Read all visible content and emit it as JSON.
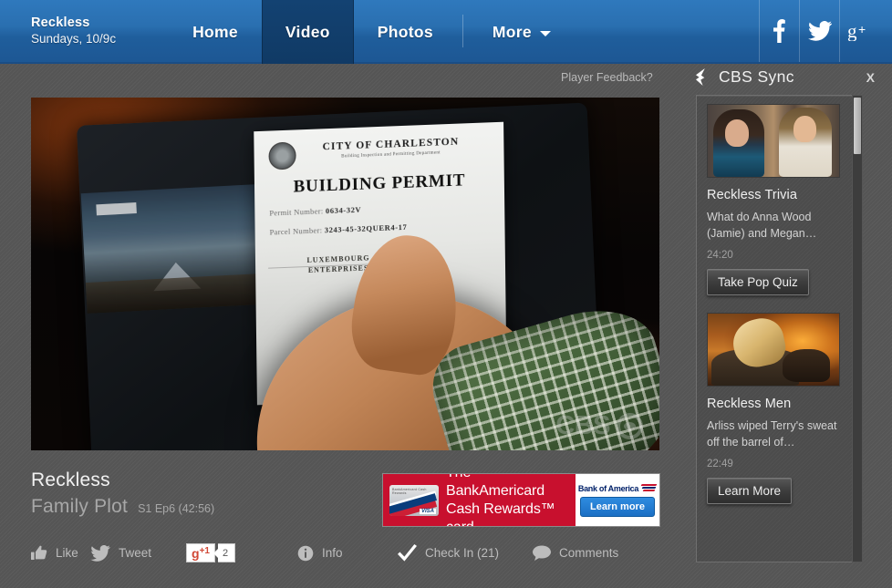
{
  "nav": {
    "brand_title": "Reckless",
    "brand_subtitle": "Sundays, 10/9c",
    "tabs": [
      {
        "label": "Home",
        "active": false
      },
      {
        "label": "Video",
        "active": true
      },
      {
        "label": "Photos",
        "active": false
      },
      {
        "label": "More",
        "active": false,
        "has_caret": true
      }
    ],
    "social": [
      {
        "name": "facebook-icon",
        "label": "f"
      },
      {
        "name": "twitter-icon",
        "label": "t"
      },
      {
        "name": "google-plus-icon",
        "label": "g+"
      }
    ]
  },
  "player_feedback": "Player Feedback?",
  "video": {
    "show_title": "Reckless",
    "episode_title": "Family Plot",
    "episode_number": "S1 Ep6 (42:56)",
    "watermark": "CBS",
    "frame": {
      "permit_city": "CITY OF CHARLESTON",
      "permit_subhead": "Building Inspection and Permitting Department",
      "permit_title": "BUILDING PERMIT",
      "permit_number_label": "Permit Number:",
      "permit_number_value": "0634-32V",
      "parcel_number_label": "Parcel Number:",
      "parcel_number_value": "3243-45-32QUER4-17",
      "owner_line1": "LUXEMBOURG",
      "owner_line2": "ENTERPRISES"
    }
  },
  "ad": {
    "headline_line1": "The BankAmericard",
    "headline_line2": "Cash Rewards™ card",
    "card_mini_text": "BankAmericard   Cash Rewards",
    "card_network": "VISA",
    "advertiser": "Bank of America",
    "cta": "Learn more"
  },
  "actions": [
    {
      "name": "like-button",
      "icon": "thumbs-up-icon",
      "label": "Like"
    },
    {
      "name": "tweet-button",
      "icon": "twitter-bird-icon",
      "label": "Tweet"
    },
    {
      "name": "google-plus-one-button",
      "icon": "gplus-icon",
      "label": "g",
      "plus": "+1",
      "count": "2"
    },
    {
      "name": "info-button",
      "icon": "info-icon",
      "label": "Info"
    },
    {
      "name": "check-in-button",
      "icon": "checkmark-icon",
      "label": "Check In (21)"
    },
    {
      "name": "comments-button",
      "icon": "speech-bubble-icon",
      "label": "Comments"
    }
  ],
  "sync": {
    "title": "CBS Sync",
    "close_label": "X",
    "cards": [
      {
        "title": "Reckless Trivia",
        "description": "What do Anna Wood (Jamie) and Megan…",
        "time": "24:20",
        "button": "Take Pop Quiz",
        "thumb": "trivia"
      },
      {
        "title": "Reckless Men",
        "description": "Arliss wiped Terry's sweat off the barrel of…",
        "time": "22:49",
        "button": "Learn More",
        "thumb": "men"
      }
    ]
  },
  "colors": {
    "nav_blue": "#2a6fb0",
    "nav_active": "#134272",
    "page_gray": "#575757",
    "ad_red": "#c8102e",
    "boa_blue": "#012169",
    "gplus_red": "#d14836"
  }
}
